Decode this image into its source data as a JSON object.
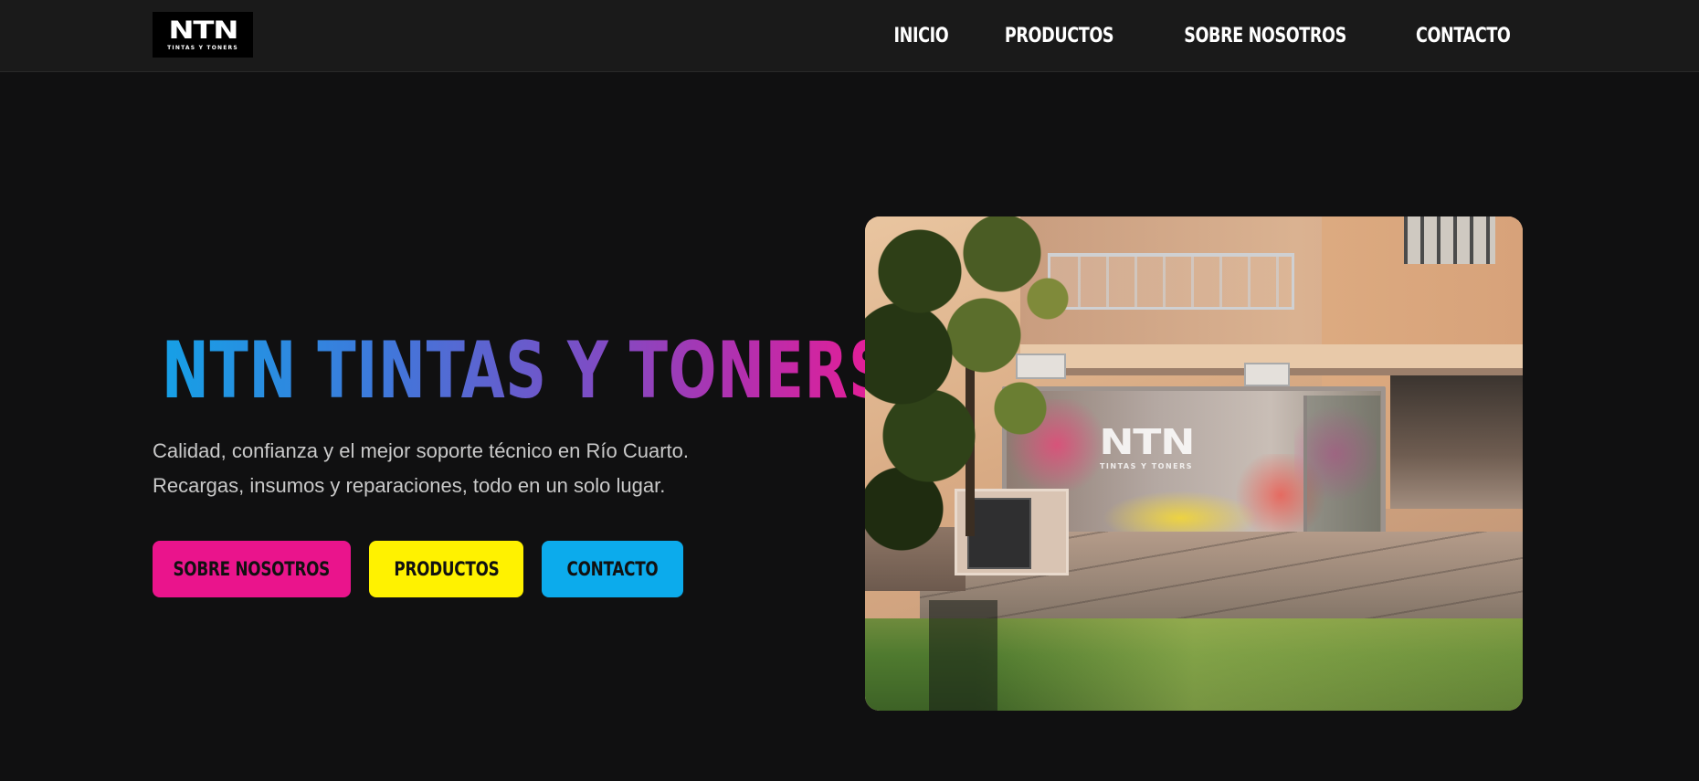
{
  "header": {
    "logo": {
      "mark": "NTN",
      "subtitle": "TINTAS Y TONERS"
    },
    "nav": [
      {
        "label": "INICIO"
      },
      {
        "label": "PRODUCTOS"
      },
      {
        "label": "SOBRE NOSOTROS"
      },
      {
        "label": "CONTACTO"
      }
    ]
  },
  "hero": {
    "title": "NTN TINTAS Y TONERS",
    "description": [
      "Calidad, confianza y el mejor soporte técnico en Río Cuarto.",
      "Recargas, insumos y reparaciones, todo en un solo lugar."
    ],
    "buttons": [
      {
        "label": "SOBRE NOSOTROS",
        "color": "#ea148c"
      },
      {
        "label": "PRODUCTOS",
        "color": "#fff200"
      },
      {
        "label": "CONTACTO",
        "color": "#0cabec"
      }
    ],
    "image": {
      "storefront_sign_mark": "NTN",
      "storefront_sign_subtitle": "TINTAS Y TONERS"
    }
  },
  "colors": {
    "background": "#101011",
    "header_background": "#1a1a1a",
    "title_gradient": [
      "#16a0e6",
      "#7a4fc6",
      "#ea1c94"
    ]
  }
}
